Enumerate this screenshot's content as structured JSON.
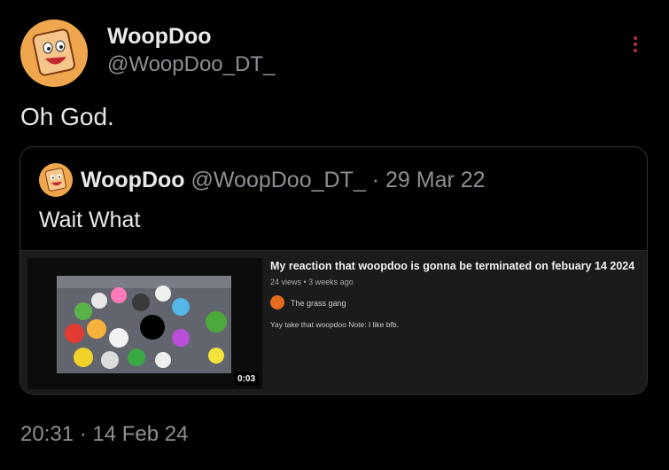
{
  "tweet": {
    "display_name": "WoopDoo",
    "handle": "@WoopDoo_DT_",
    "text": "Oh God.",
    "timestamp": "20:31 · 14 Feb 24",
    "more_icon": "more-vertical-icon",
    "accent_color": "#b0313b"
  },
  "quote": {
    "display_name": "WoopDoo",
    "handle": "@WoopDoo_DT_",
    "separator": "·",
    "date": "29 Mar 22",
    "text": "Wait What",
    "embed": {
      "duration": "0:03",
      "title": "My reaction that woopdoo is gonna be terminated on febuary 14 2024",
      "meta": "24 views • 3 weeks ago",
      "channel": "The grass gang",
      "description": "Yay take that woopdoo Note: I like bfb."
    }
  }
}
